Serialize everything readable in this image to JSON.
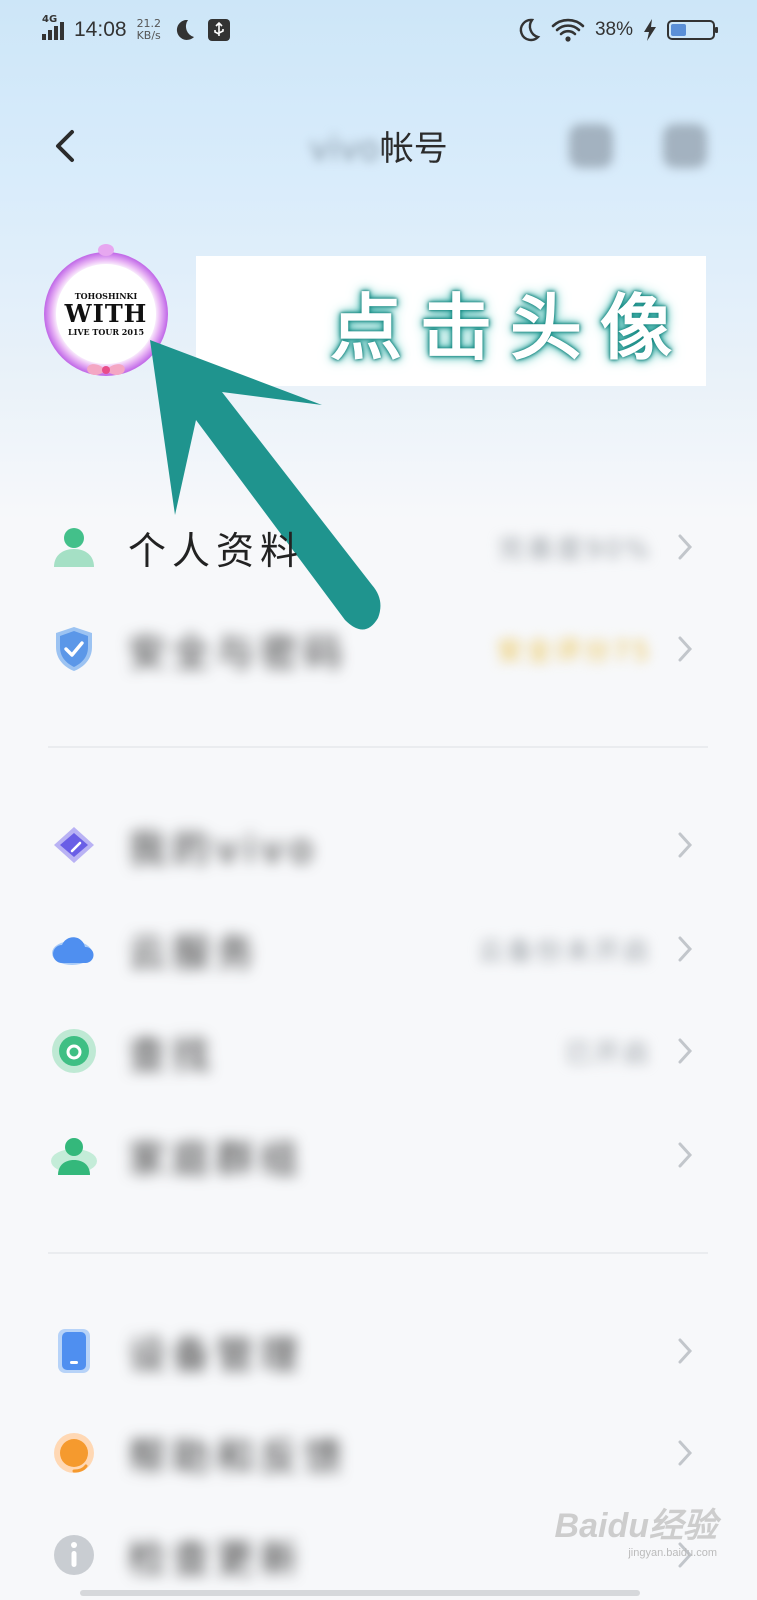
{
  "status_bar": {
    "network": "4G",
    "time": "14:08",
    "speed_value": "21.2",
    "speed_unit": "KB/s",
    "battery_percent": "38%",
    "battery_level": 0.38
  },
  "header": {
    "title_brand": "vivo",
    "title_suffix": "帐号"
  },
  "hint": {
    "text": "点击头像"
  },
  "avatar": {
    "line1": "WITH",
    "line2": "LIVE TOUR 2015",
    "top_text": "TOHOSHINKI"
  },
  "menu": {
    "group1": [
      {
        "label": "个人资料",
        "value": "完善度90%"
      },
      {
        "label": "安全与密码",
        "value": "安全评分75"
      }
    ],
    "group2": [
      {
        "label": "我的vivo",
        "value": ""
      },
      {
        "label": "云服务",
        "value": "云备份未开启"
      },
      {
        "label": "查找",
        "value": "已开启"
      },
      {
        "label": "家庭群组",
        "value": ""
      }
    ],
    "group3": [
      {
        "label": "设备管理",
        "value": ""
      },
      {
        "label": "帮助和反馈",
        "value": ""
      },
      {
        "label": "检查更新",
        "value": ""
      }
    ]
  },
  "watermark": {
    "brand": "Baidu经验",
    "url": "jingyan.baidu.com"
  },
  "colors": {
    "arrow": "#1f948e",
    "accent_green": "#4cc08a",
    "shield_blue": "#5b97e8"
  }
}
